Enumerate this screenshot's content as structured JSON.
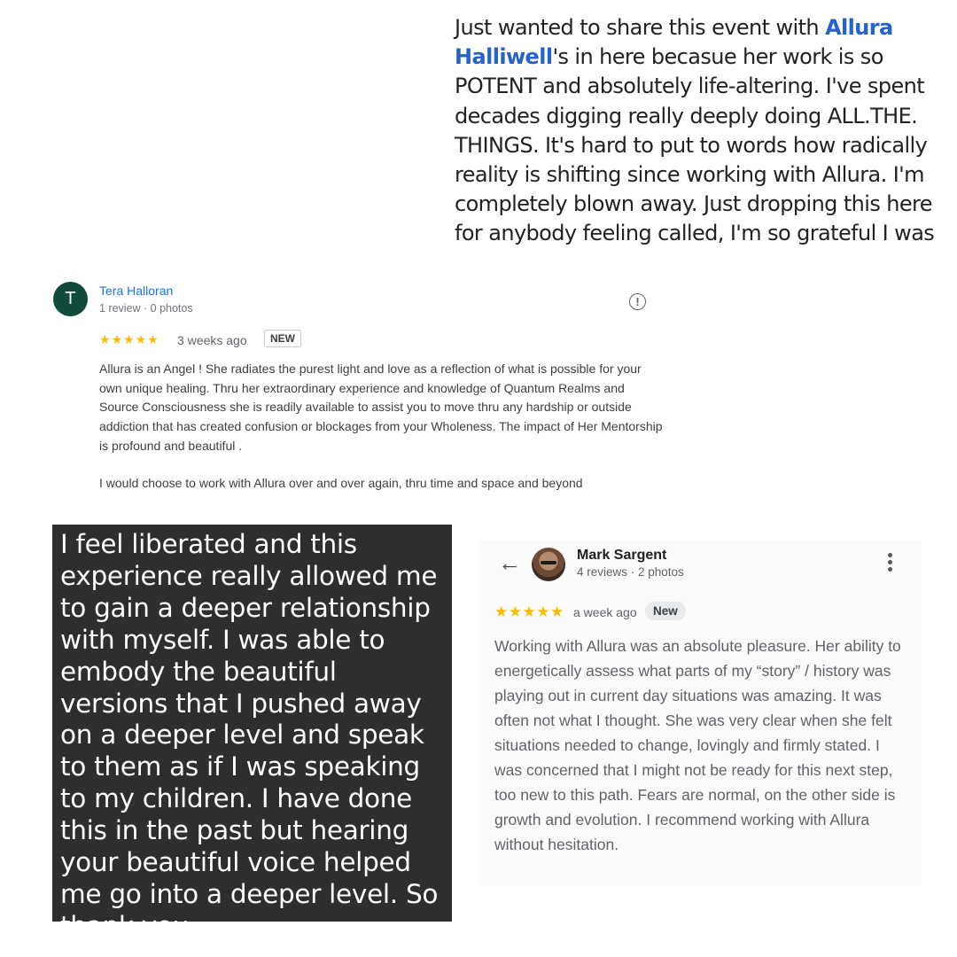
{
  "post": {
    "mention": "Allura Halliwell",
    "before": "Just wanted to share this event with ",
    "after": "'s in here becasue her work is so POTENT and absolutely life-altering. I've spent decades digging really deeply doing ALL.THE. THINGS. It's hard to put to words how radically reality is shifting since working with Allura. I'm completely blown away. Just dropping this here for anybody feeling called, I'm so grateful I was"
  },
  "review1": {
    "avatar_letter": "T",
    "name": "Tera Halloran",
    "meta": "1 review · 0 photos",
    "stars": "★★★★★",
    "date": "3 weeks ago",
    "badge": "NEW",
    "flag_icon": "report-flag-icon",
    "text": "Allura is an Angel ! She radiates the purest light and love as a reflection of what is possible for your own unique healing. Thru her extraordinary experience and knowledge of Quantum Realms and Source Consciousness she is readily available to assist you to move thru any hardship or outside addiction that has created confusion or blockages from your Wholeness. The impact of Her Mentorship is profound and beautiful .",
    "text2": "I would choose to work with Allura over and over again, thru time and space and beyond"
  },
  "testimonial": {
    "text": "I feel liberated and this experience really allowed me to gain a deeper relationship with myself. I was able to embody the beautiful versions that I pushed away on a deeper level and speak to them as if I was speaking to my children. I have done this in the past but hearing your beautiful voice helped me go into a deeper level. So thank you."
  },
  "review2": {
    "name": "Mark Sargent",
    "meta": "4 reviews · 2 photos",
    "stars": "★★★★★",
    "date": "a week ago",
    "badge": "New",
    "back_icon": "arrow-left-icon",
    "more_icon": "more-vertical-icon",
    "text": "Working with Allura was an absolute pleasure. Her ability to energetically assess what parts of my “story” / history was playing out in current day situations was amazing. It was often not what I thought. She was very clear when she felt situations needed to change, lovingly and firmly stated. I was concerned that I might not be ready for this next step, too new to this path. Fears are normal, on the other side is growth and evolution. I recommend working with Allura without hesitation."
  },
  "colors": {
    "link_blue": "#1a73e8",
    "mention_blue": "#2563c9",
    "star_gold": "#fbbc04",
    "avatar_green": "#0f4a3c",
    "dark_box": "#2e2e2e"
  }
}
